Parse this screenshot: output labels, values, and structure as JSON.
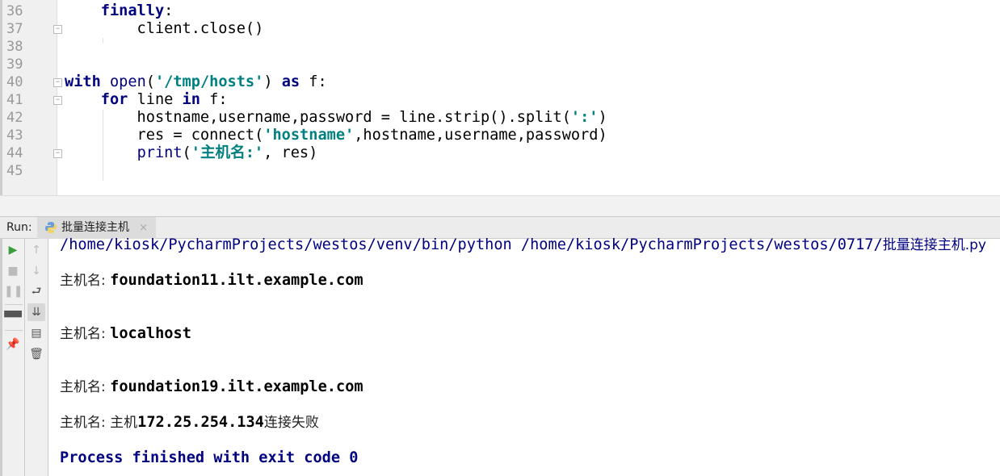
{
  "editor": {
    "lines": [
      {
        "num": "36",
        "tokens": [
          {
            "t": "    "
          },
          {
            "t": "finally",
            "c": "kw"
          },
          {
            "t": ":"
          }
        ]
      },
      {
        "num": "37",
        "tokens": [
          {
            "t": "        client.close()"
          }
        ]
      },
      {
        "num": "38",
        "tokens": []
      },
      {
        "num": "39",
        "tokens": []
      },
      {
        "num": "40",
        "tokens": [
          {
            "t": "with",
            "c": "kw"
          },
          {
            "t": " "
          },
          {
            "t": "open",
            "c": "bi"
          },
          {
            "t": "("
          },
          {
            "t": "'/tmp/hosts'",
            "c": "str"
          },
          {
            "t": ") "
          },
          {
            "t": "as",
            "c": "kw"
          },
          {
            "t": " f:"
          }
        ]
      },
      {
        "num": "41",
        "tokens": [
          {
            "t": "    "
          },
          {
            "t": "for",
            "c": "kw"
          },
          {
            "t": " line "
          },
          {
            "t": "in",
            "c": "kw"
          },
          {
            "t": " f:"
          }
        ]
      },
      {
        "num": "42",
        "tokens": [
          {
            "t": "        hostname,username,password = line.strip().split("
          },
          {
            "t": "':'",
            "c": "str"
          },
          {
            "t": ")"
          }
        ]
      },
      {
        "num": "43",
        "tokens": [
          {
            "t": "        res = connect("
          },
          {
            "t": "'hostname'",
            "c": "str"
          },
          {
            "t": ",hostname,username,password)"
          }
        ]
      },
      {
        "num": "44",
        "tokens": [
          {
            "t": "        "
          },
          {
            "t": "print",
            "c": "bi"
          },
          {
            "t": "("
          },
          {
            "t": "'主机名:'",
            "c": "str"
          },
          {
            "t": ", res)"
          }
        ]
      },
      {
        "num": "45",
        "tokens": []
      }
    ]
  },
  "run": {
    "label": "Run:",
    "tab_label": "批量连接主机",
    "tab_close": "×",
    "toolbar_left": [
      "run-icon",
      "stop-icon",
      "pause-icon",
      "layout-icon",
      "pin-icon"
    ],
    "toolbar_right": [
      "up-arrow-icon",
      "down-arrow-icon",
      "soft-wrap-icon",
      "scroll-to-end-icon",
      "print-icon",
      "trash-icon"
    ],
    "console": {
      "command": "/home/kiosk/PycharmProjects/westos/venv/bin/python /home/kiosk/PycharmProjects/westos/0717/",
      "command_file": "批量连接主机.py",
      "outputs": [
        {
          "prefix": "主机名: ",
          "value": "foundation11.ilt.example.com"
        },
        {
          "prefix": "主机名: ",
          "value": "localhost"
        },
        {
          "prefix": "主机名: ",
          "value": "foundation19.ilt.example.com"
        },
        {
          "prefix": "主机名: ",
          "pre": "主机",
          "value": "172.25.254.134",
          "post": "连接失败"
        }
      ],
      "exit_message": "Process finished with exit code 0"
    }
  },
  "colors": {
    "keyword": "#000080",
    "string": "#008080",
    "run_green": "#3a9d3a"
  }
}
